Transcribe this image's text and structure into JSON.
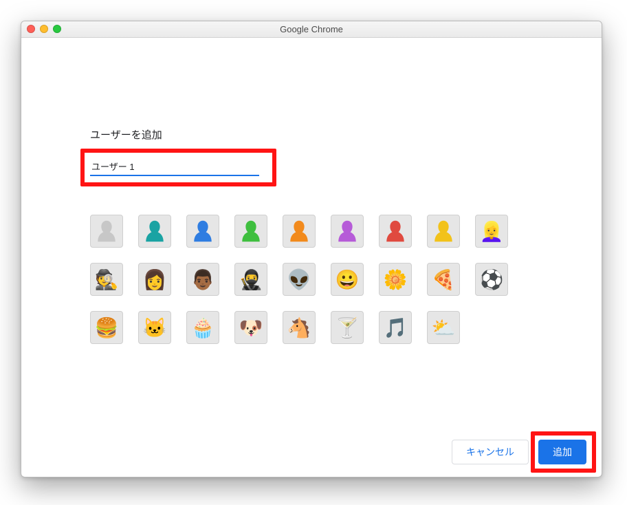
{
  "window": {
    "title": "Google Chrome"
  },
  "dialog": {
    "heading": "ユーザーを追加",
    "name_value": "ユーザー 1",
    "cancel_label": "キャンセル",
    "add_label": "追加"
  },
  "avatars": {
    "row1": [
      {
        "name": "avatar-generic-grey",
        "type": "silhouette",
        "color": "#c7c7c7"
      },
      {
        "name": "avatar-generic-teal",
        "type": "silhouette",
        "color": "#1aa3a3"
      },
      {
        "name": "avatar-generic-blue",
        "type": "silhouette",
        "color": "#2f7de1"
      },
      {
        "name": "avatar-generic-green",
        "type": "silhouette",
        "color": "#3fbf3f"
      },
      {
        "name": "avatar-generic-orange",
        "type": "silhouette",
        "color": "#f28a1c"
      },
      {
        "name": "avatar-generic-purple",
        "type": "silhouette",
        "color": "#b65bd8"
      },
      {
        "name": "avatar-generic-red",
        "type": "silhouette",
        "color": "#e04a3f"
      },
      {
        "name": "avatar-generic-yellow",
        "type": "silhouette",
        "color": "#f2c21a"
      },
      {
        "name": "avatar-female-blonde",
        "type": "emoji",
        "glyph": "👱‍♀️"
      }
    ],
    "row2": [
      {
        "name": "avatar-agent",
        "type": "emoji",
        "glyph": "🕵️"
      },
      {
        "name": "avatar-woman",
        "type": "emoji",
        "glyph": "👩"
      },
      {
        "name": "avatar-man",
        "type": "emoji",
        "glyph": "👨🏾"
      },
      {
        "name": "avatar-ninja",
        "type": "emoji",
        "glyph": "🥷"
      },
      {
        "name": "avatar-alien",
        "type": "emoji",
        "glyph": "👽"
      },
      {
        "name": "avatar-smiley",
        "type": "emoji",
        "glyph": "😀"
      },
      {
        "name": "avatar-flower",
        "type": "emoji",
        "glyph": "🌼"
      },
      {
        "name": "avatar-pizza",
        "type": "emoji",
        "glyph": "🍕"
      },
      {
        "name": "avatar-soccer",
        "type": "emoji",
        "glyph": "⚽"
      }
    ],
    "row3": [
      {
        "name": "avatar-burger",
        "type": "emoji",
        "glyph": "🍔"
      },
      {
        "name": "avatar-cat",
        "type": "emoji",
        "glyph": "🐱"
      },
      {
        "name": "avatar-cupcake",
        "type": "emoji",
        "glyph": "🧁"
      },
      {
        "name": "avatar-dog",
        "type": "emoji",
        "glyph": "🐶"
      },
      {
        "name": "avatar-horse",
        "type": "emoji",
        "glyph": "🐴"
      },
      {
        "name": "avatar-cocktail",
        "type": "emoji",
        "glyph": "🍸"
      },
      {
        "name": "avatar-music",
        "type": "emoji",
        "glyph": "🎵"
      },
      {
        "name": "avatar-weather",
        "type": "emoji",
        "glyph": "⛅"
      }
    ]
  },
  "highlights": {
    "name_input": true,
    "add_button": true
  }
}
